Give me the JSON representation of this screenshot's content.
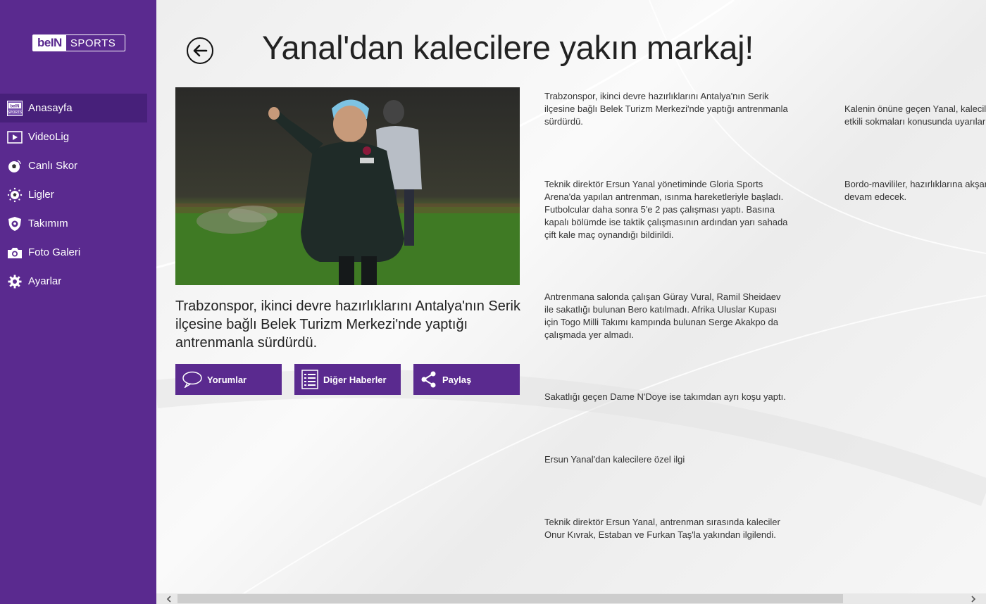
{
  "logo": {
    "bein": "beIN",
    "sports": "SPORTS"
  },
  "nav": [
    {
      "label": "Anasayfa",
      "icon": "bein-icon"
    },
    {
      "label": "VideoLig",
      "icon": "play-icon"
    },
    {
      "label": "Canlı Skor",
      "icon": "live-ball-icon"
    },
    {
      "label": "Ligler",
      "icon": "league-ball-icon"
    },
    {
      "label": "Takımım",
      "icon": "shield-icon"
    },
    {
      "label": "Foto Galeri",
      "icon": "camera-icon"
    },
    {
      "label": "Ayarlar",
      "icon": "gear-icon"
    }
  ],
  "article": {
    "title": "Yanal'dan kalecilere yakın markaj!",
    "lead": "Trabzonspor, ikinci devre hazırlıklarını Antalya'nın Serik ilçesine bağlı Belek Turizm Merkezi'nde yaptığı antrenmanla sürdürdü.",
    "paragraphs": [
      "Trabzonspor, ikinci devre hazırlıklarını Antalya'nın Serik ilçesine bağlı Belek Turizm Merkezi'nde yaptığı antrenmanla sürdürdü.",
      "Teknik direktör Ersun Yanal yönetiminde Gloria Sports Arena'da yapılan antrenman, ısınma hareketleriyle başladı. Futbolcular daha sonra 5'e 2 pas çalışması yaptı. Basına kapalı bölümde ise taktik çalışmasının ardından yarı sahada çift kale maç oynandığı bildirildi.",
      "Antrenmana salonda çalışan Güray Vural, Ramil Sheidaev ile sakatlığı bulunan Bero katılmadı. Afrika Uluslar Kupası için Togo Milli Takımı kampında bulunan Serge Akakpo da çalışmada yer almadı.",
      "Sakatlığı geçen Dame N'Doye ise takımdan ayrı koşu yaptı.",
      "Ersun Yanal'dan kalecilere özel ilgi",
      "Teknik direktör Ersun Yanal, antrenman sırasında kaleciler Onur Kıvrak, Estaban ve Furkan Taş'la yakından ilgilendi."
    ],
    "paragraphs_col3": [
      "Kalenin önüne geçen Yanal, kalecil etkili sokmaları konusunda uyarılar",
      "Bordo-mavililer, hazırlıklarına akşar devam edecek."
    ]
  },
  "actions": {
    "comments": "Yorumlar",
    "other_news": "Diğer Haberler",
    "share": "Paylaş"
  },
  "colors": {
    "brand": "#5a2a8f",
    "active": "#47207a"
  }
}
